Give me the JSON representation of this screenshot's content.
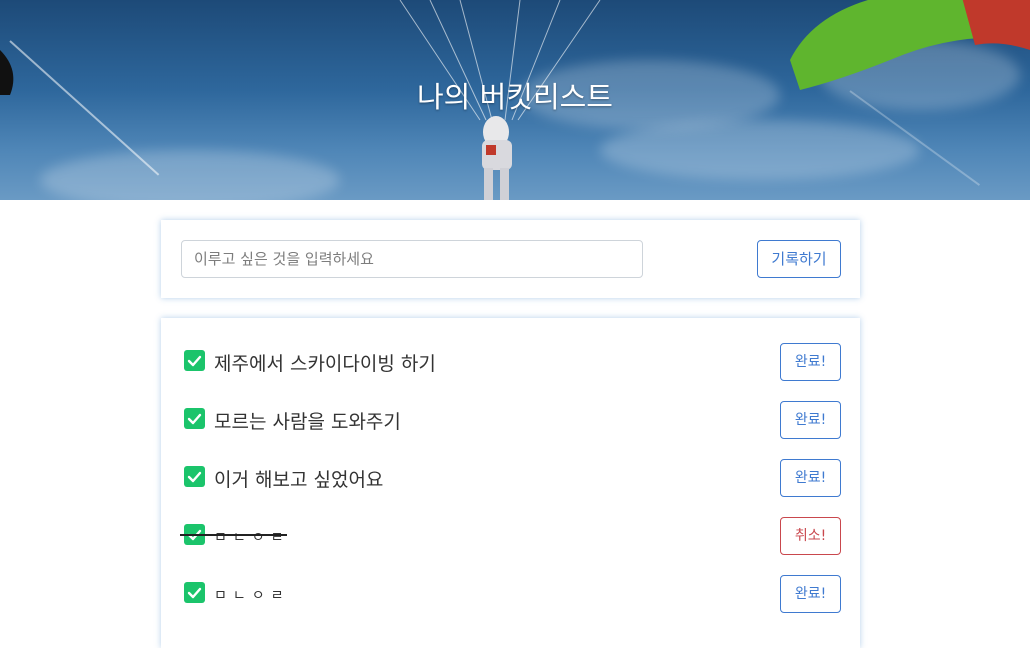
{
  "header": {
    "title": "나의 버킷리스트"
  },
  "post": {
    "placeholder": "이루고 싶은 것을 입력하세요",
    "button_label": "기록하기"
  },
  "colors": {
    "accent": "#3f7ad0",
    "danger": "#c9474d",
    "check": "#1bc46b"
  },
  "buckets": [
    {
      "text": "제주에서 스카이다이빙 하기",
      "done": false,
      "button_label": "완료!"
    },
    {
      "text": "모르는 사람을 도와주기",
      "done": false,
      "button_label": "완료!"
    },
    {
      "text": "이거 해보고 싶었어요",
      "done": false,
      "button_label": "완료!"
    },
    {
      "text": "ㅁㄴㅇㄹ",
      "done": true,
      "button_label": "취소!"
    },
    {
      "text": "ㅁㄴㅇㄹ",
      "done": false,
      "button_label": "완료!"
    }
  ]
}
